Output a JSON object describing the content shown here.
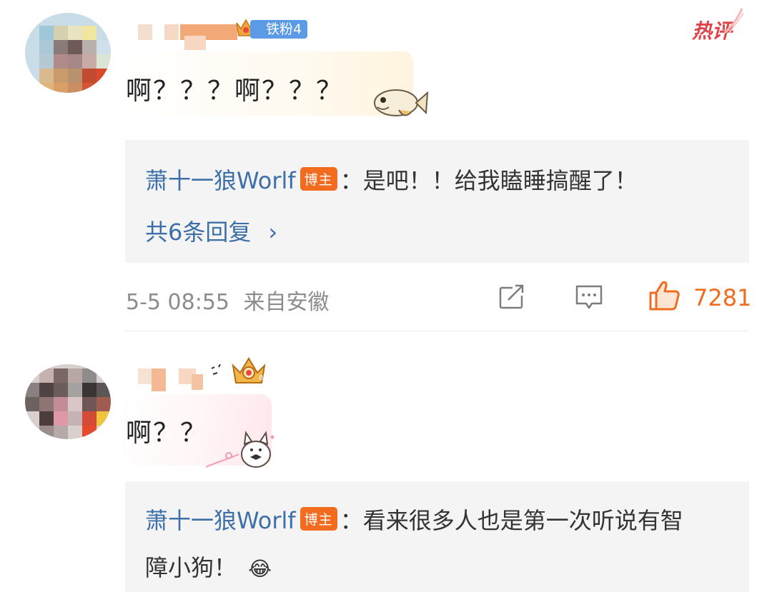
{
  "comments": [
    {
      "text": "啊？？？啊？？？",
      "fan_badge": "铁粉4",
      "hot_label": "热评",
      "reply": {
        "author": "萧十一狼Worlf",
        "role_badge": "博主",
        "text": "：是吧！！给我瞌睡搞醒了！",
        "more_label": "共6条回复",
        "more_chevron": "›"
      },
      "meta": {
        "time": "5-5 08:55",
        "location": "来自安徽",
        "likes": "7281"
      },
      "icons": [
        "share-icon",
        "comment-icon",
        "like-icon"
      ]
    },
    {
      "text": "啊？？",
      "reply": {
        "author": "萧十一狼Worlf",
        "role_badge": "博主",
        "text_line1": "：看来很多人也是第一次听说有智",
        "text_line2": "障小狗！",
        "emoji": "😂"
      }
    }
  ],
  "colors": {
    "author": "#3d6fa8",
    "accent": "#f26c1f",
    "reply_bg": "#f4f4f5",
    "meta": "#8c8c8c",
    "fan_badge": "#5b9be6",
    "hot": "#e0434a"
  }
}
